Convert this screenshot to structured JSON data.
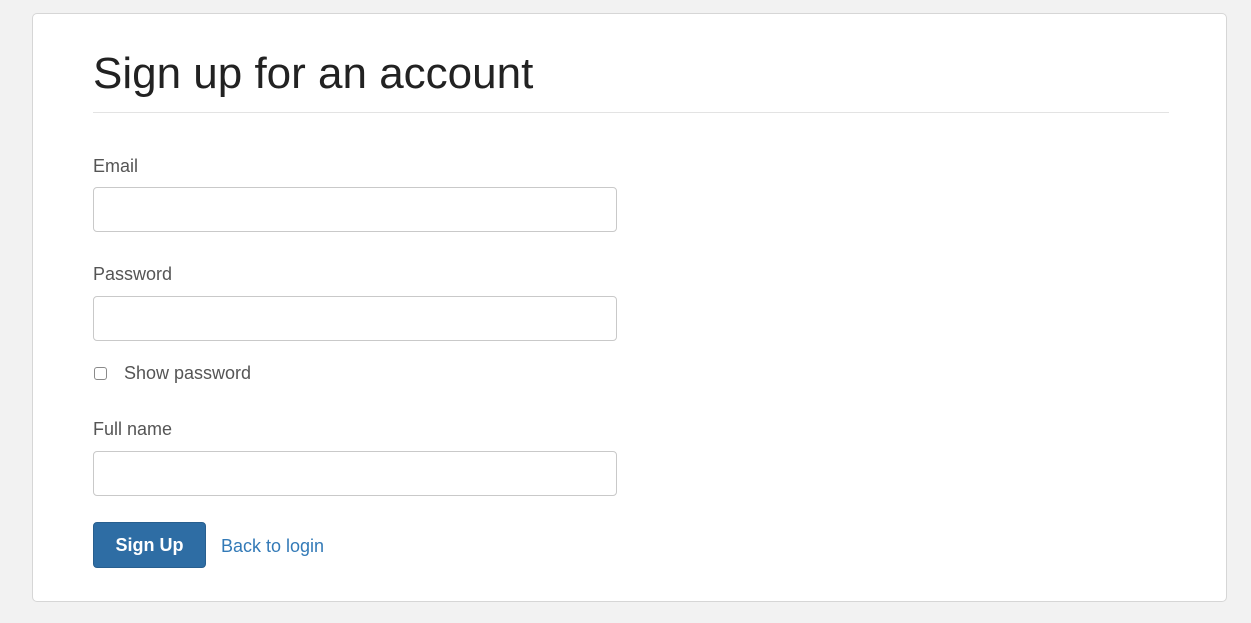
{
  "form": {
    "title": "Sign up for an account",
    "email": {
      "label": "Email",
      "value": "",
      "placeholder": ""
    },
    "password": {
      "label": "Password",
      "value": "",
      "placeholder": ""
    },
    "show_password": {
      "label": "Show password",
      "checked": false
    },
    "full_name": {
      "label": "Full name",
      "value": "",
      "placeholder": ""
    },
    "submit_label": "Sign Up",
    "back_link_label": "Back to login"
  },
  "colors": {
    "page_background": "#f2f2f2",
    "panel_background": "#ffffff",
    "primary_button": "#2e6da4",
    "link": "#337ab7",
    "label_text": "#555555",
    "title_text": "#222222"
  }
}
